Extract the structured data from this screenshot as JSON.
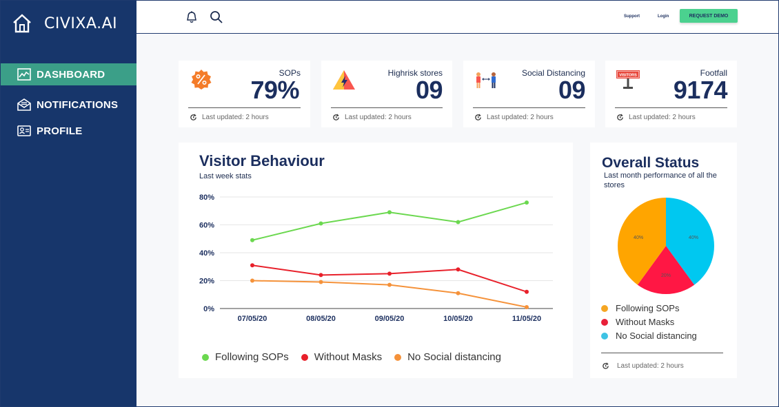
{
  "app": {
    "brand": "CIVIXA.AI"
  },
  "sidebar": {
    "items": [
      {
        "label": "DASHBOARD",
        "icon": "chart-icon",
        "active": true
      },
      {
        "label": "NOTIFICATIONS",
        "icon": "mail-icon",
        "active": false
      },
      {
        "label": "PROFILE",
        "icon": "profile-icon",
        "active": false
      }
    ]
  },
  "topbar": {
    "support_label": "Support",
    "login_label": "Login",
    "demo_label": "REQUEST DEMO",
    "icons": [
      "bell-icon",
      "search-icon"
    ]
  },
  "stats": [
    {
      "label": "SOPs",
      "value": "79%",
      "updated": "Last updated: 2 hours",
      "icon": "percent-badge-icon"
    },
    {
      "label": "Highrisk stores",
      "value": "09",
      "updated": "Last updated: 2 hours",
      "icon": "warning-triangle-icon"
    },
    {
      "label": "Social Distancing",
      "value": "09",
      "updated": "Last updated: 2 hours",
      "icon": "people-distance-icon"
    },
    {
      "label": "Footfall",
      "value": "9174",
      "updated": "Last updated: 2 hours",
      "icon": "visitors-sign-icon",
      "icon_text": "VISITORS"
    }
  ],
  "visitor_behaviour": {
    "title": "Visitor Behaviour",
    "subtitle": "Last week stats"
  },
  "overall_status": {
    "title": "Overall Status",
    "subtitle": "Last month performance of all the stores",
    "updated": "Last updated: 2 hours"
  },
  "colors": {
    "sidebar": "#17366b",
    "active": "#3b9f88",
    "green": "#6bd84f",
    "red": "#e8202a",
    "orange": "#f5923a",
    "pie_orange": "#ffa500",
    "pie_red": "#ff1744",
    "pie_blue": "#00c8f0"
  },
  "chart_data": [
    {
      "type": "line",
      "categories": [
        "07/05/20",
        "08/05/20",
        "09/05/20",
        "10/05/20",
        "11/05/20"
      ],
      "ylim": [
        0,
        80
      ],
      "yticks": [
        "0%",
        "20%",
        "40%",
        "60%",
        "80%"
      ],
      "grid": true,
      "legend_position": "bottom",
      "series": [
        {
          "name": "Following SOPs",
          "values": [
            49,
            61,
            69,
            62,
            76
          ],
          "color": "#6bd84f"
        },
        {
          "name": "Without Masks",
          "values": [
            31,
            24,
            25,
            28,
            12
          ],
          "color": "#e8202a"
        },
        {
          "name": "No Social distancing",
          "values": [
            20,
            19,
            17,
            11,
            1
          ],
          "color": "#f5923a"
        }
      ]
    },
    {
      "type": "pie",
      "legend_position": "bottom",
      "slices": [
        {
          "name": "Following SOPs",
          "value": 40,
          "label": "40%",
          "color": "#ffa500",
          "legend_color": "#f5a623"
        },
        {
          "name": "Without Masks",
          "value": 20,
          "label": "20%",
          "color": "#ff1744",
          "legend_color": "#e8203a"
        },
        {
          "name": "No Social distancing",
          "value": 40,
          "label": "40%",
          "color": "#00c8f0",
          "legend_color": "#3ec3e4"
        }
      ]
    }
  ]
}
